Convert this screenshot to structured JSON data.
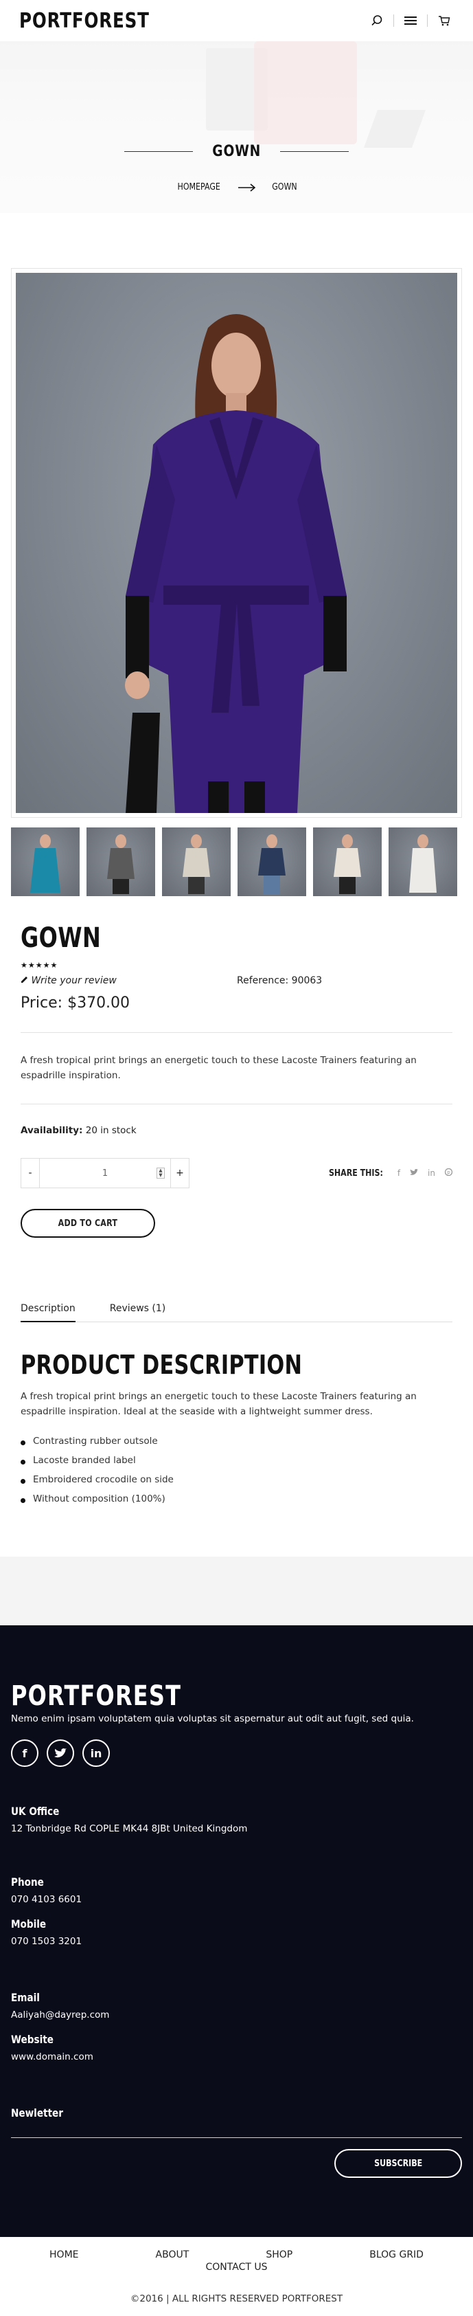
{
  "header": {
    "logo": "PORTFOREST",
    "icons": [
      "search-icon",
      "menu-icon",
      "cart-icon"
    ]
  },
  "hero": {
    "title": "GOWN",
    "breadcrumb": {
      "home": "HOMEPAGE",
      "current": "GOWN"
    }
  },
  "product": {
    "name": "GOWN",
    "rating_stars": "★★★★★",
    "write_review": "Write your review",
    "reference": "Reference: 90063",
    "price": "Price: $370.00",
    "short_description": "A fresh tropical print brings an energetic touch to these Lacoste Trainers featuring an espadrille inspiration.",
    "availability_label": "Availability:",
    "availability_value": "20 in stock",
    "quantity": "1",
    "qty_minus": "-",
    "qty_plus": "+",
    "share_label": "SHARE THIS:",
    "share_icons": [
      "f",
      "t",
      "in",
      "p"
    ],
    "add_to_cart": "ADD TO CART",
    "thumbnail_colors": [
      "#1a8aa8",
      "#5a5a5a",
      "#d8d2c6",
      "#2a3a5a",
      "#e8e2d8",
      "#ecebe8"
    ],
    "main_coat_color": "#3a1f7a"
  },
  "tabs": {
    "description": "Description",
    "reviews": "Reviews (1)"
  },
  "description": {
    "heading": "PRODUCT DESCRIPTION",
    "text": "A fresh tropical print brings an energetic touch to these Lacoste Trainers featuring an espadrille inspiration. Ideal at the seaside with a lightweight summer dress.",
    "bullets": [
      "Contrasting rubber outsole",
      "Lacoste branded label",
      "Embroidered crocodile on side",
      "Without composition (100%)"
    ]
  },
  "footer": {
    "logo": "PORTFOREST",
    "tagline": "Nemo enim ipsam voluptatem quia voluptas sit aspernatur aut odit aut fugit, sed quia.",
    "socials": [
      "f",
      "t",
      "in"
    ],
    "office_title": "UK Office",
    "office_address": "12 Tonbridge Rd COPLE MK44 8JBt United Kingdom",
    "phone_title": "Phone",
    "phone": "070 4103 6601",
    "mobile_title": "Mobile",
    "mobile": "070 1503 3201",
    "email_title": "Email",
    "email": "Aaliyah@dayrep.com",
    "website_title": "Website",
    "website": "www.domain.com",
    "newsletter_title": "Newletter",
    "subscribe": "SUBSCRIBE",
    "background": "#0b0c1a"
  },
  "bottom_nav": {
    "items": [
      "HOME",
      "ABOUT",
      "SHOP",
      "BLOG GRID"
    ],
    "contact": "CONTACT US",
    "copyright": "©2016 | ALL RIGHTS RESERVED PORTFOREST"
  }
}
